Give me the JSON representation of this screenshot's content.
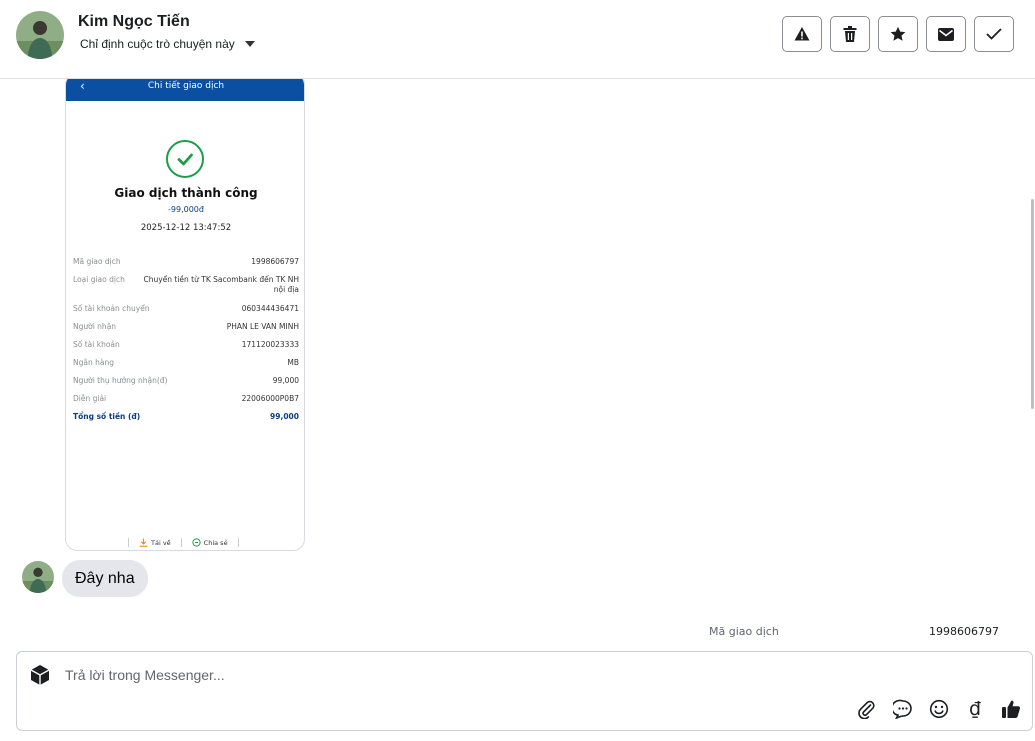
{
  "header": {
    "contact_name": "Kim Ngọc Tiến",
    "assign_label": "Chỉ định cuộc trò chuyện này",
    "actions": [
      "warning-icon",
      "trash-icon",
      "star-icon",
      "envelope-icon",
      "check-icon"
    ]
  },
  "receipt": {
    "back_glyph": "‹",
    "screen_title": "Chi tiết giao dịch",
    "status": "Giao dịch thành công",
    "amount": "-99,000đ",
    "datetime": "2025-12-12 13:47:52",
    "rows": [
      {
        "label": "Mã giao dịch",
        "value": "1998606797"
      },
      {
        "label": "Loại giao dịch",
        "value": "Chuyển tiền từ TK Sacombank đến TK NH nội địa"
      },
      {
        "label": "Số tài khoản chuyển",
        "value": "060344436471"
      },
      {
        "label": "Người nhận",
        "value": "PHAN LE VAN MINH"
      },
      {
        "label": "Số tài khoản",
        "value": "171120023333"
      },
      {
        "label": "Ngân hàng",
        "value": "MB"
      },
      {
        "label": "Người thụ hưởng nhận(đ)",
        "value": "99,000"
      },
      {
        "label": "Diễn giải",
        "value": "22006000P0B7"
      }
    ],
    "total": {
      "label": "Tổng số tiền (đ)",
      "value": "99,000"
    },
    "download_label": "Tải về",
    "share_label": "Chia sẻ"
  },
  "message": {
    "text": "Đây nha"
  },
  "peek": {
    "label": "Mã giao dịch",
    "value": "1998606797"
  },
  "composer": {
    "placeholder": "Trả lời trong Messenger...",
    "currency_glyph": "₫"
  },
  "colors": {
    "receipt_header": "#0a4fa1",
    "success": "#1e9d49",
    "bubble": "#e4e6eb"
  }
}
